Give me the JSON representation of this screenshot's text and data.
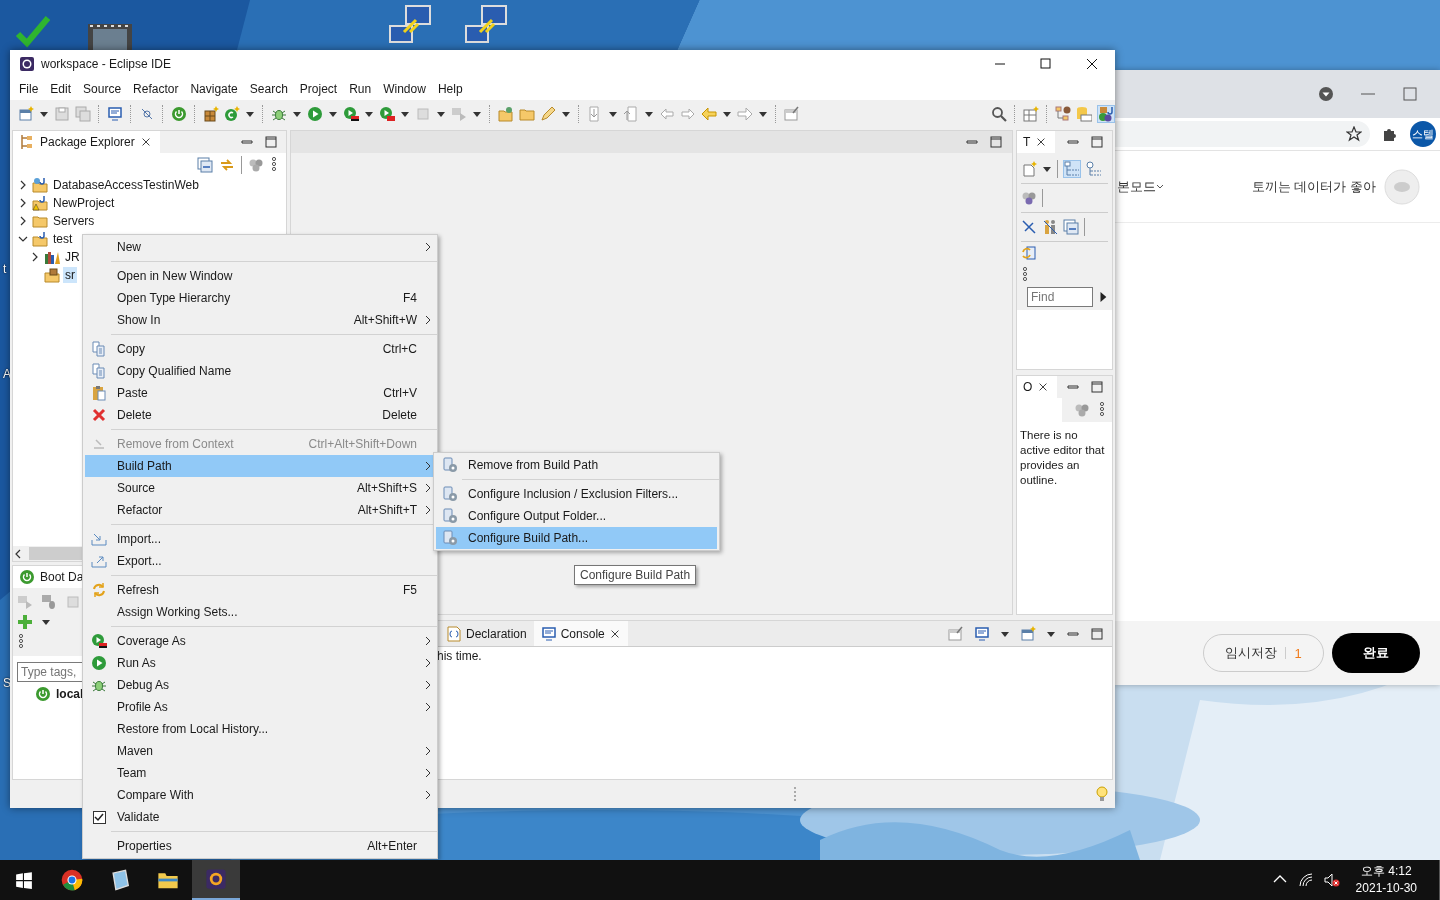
{
  "desktop": {
    "edge_labels": [
      "t",
      "A",
      "S"
    ]
  },
  "browser": {
    "mode_menu": "본모드",
    "blog_name": "토끼는 데이터가 좋아",
    "profile_badge": "스텔",
    "draft_button": {
      "label": "임시저장",
      "count": "1"
    },
    "done_button": "완료"
  },
  "window": {
    "title": "workspace - Eclipse IDE"
  },
  "menu_bar": [
    "File",
    "Edit",
    "Source",
    "Refactor",
    "Navigate",
    "Search",
    "Project",
    "Run",
    "Window",
    "Help"
  ],
  "package_explorer": {
    "title": "Package Explorer",
    "tree": [
      {
        "label": "DatabaseAccessTestinWeb",
        "kind": "web-project",
        "expanded": false,
        "selected": false
      },
      {
        "label": "NewProject",
        "kind": "warning-project",
        "expanded": false,
        "selected": false
      },
      {
        "label": "Servers",
        "kind": "folder",
        "expanded": false,
        "selected": false
      },
      {
        "label": "test",
        "kind": "project",
        "expanded": true,
        "selected": false,
        "children": [
          {
            "label": "JR",
            "kind": "library",
            "expanded": false,
            "selected": false
          },
          {
            "label": "sr",
            "kind": "source",
            "selected": true
          }
        ]
      }
    ]
  },
  "boot_dashboard": {
    "title": "Boot Da",
    "filter_placeholder": "Type tags,",
    "items": [
      {
        "label": "local"
      }
    ]
  },
  "task_list": {
    "title": "T",
    "find_placeholder": "Find"
  },
  "outline": {
    "title": "O",
    "message": "There is no active editor that provides an outline."
  },
  "bottom_panel": {
    "tabs": [
      {
        "label": "Declaration",
        "selected": false
      },
      {
        "label": "Console",
        "selected": true
      }
    ],
    "console_text": "his time."
  },
  "context_menu": {
    "items": [
      {
        "kind": "item",
        "label": "New",
        "submenu": true,
        "selected": false,
        "disabled": false
      },
      {
        "kind": "separator"
      },
      {
        "kind": "item",
        "label": "Open in New Window",
        "submenu": false,
        "selected": false,
        "disabled": false
      },
      {
        "kind": "item",
        "label": "Open Type Hierarchy",
        "shortcut": "F4",
        "submenu": false,
        "selected": false,
        "disabled": false
      },
      {
        "kind": "item",
        "label": "Show In",
        "shortcut": "Alt+Shift+W",
        "submenu": true,
        "selected": false,
        "disabled": false
      },
      {
        "kind": "separator"
      },
      {
        "kind": "item",
        "label": "Copy",
        "shortcut": "Ctrl+C",
        "submenu": false,
        "selected": false,
        "disabled": false
      },
      {
        "kind": "item",
        "label": "Copy Qualified Name",
        "submenu": false,
        "selected": false,
        "disabled": false
      },
      {
        "kind": "item",
        "label": "Paste",
        "shortcut": "Ctrl+V",
        "submenu": false,
        "selected": false,
        "disabled": false
      },
      {
        "kind": "item",
        "label": "Delete",
        "shortcut": "Delete",
        "submenu": false,
        "selected": false,
        "disabled": false
      },
      {
        "kind": "separator"
      },
      {
        "kind": "item",
        "label": "Remove from Context",
        "shortcut": "Ctrl+Alt+Shift+Down",
        "submenu": false,
        "selected": false,
        "disabled": true
      },
      {
        "kind": "item",
        "label": "Build Path",
        "submenu": true,
        "selected": true,
        "disabled": false
      },
      {
        "kind": "item",
        "label": "Source",
        "shortcut": "Alt+Shift+S",
        "submenu": true,
        "selected": false,
        "disabled": false
      },
      {
        "kind": "item",
        "label": "Refactor",
        "shortcut": "Alt+Shift+T",
        "submenu": true,
        "selected": false,
        "disabled": false
      },
      {
        "kind": "separator"
      },
      {
        "kind": "item",
        "label": "Import...",
        "submenu": false,
        "selected": false,
        "disabled": false
      },
      {
        "kind": "item",
        "label": "Export...",
        "submenu": false,
        "selected": false,
        "disabled": false
      },
      {
        "kind": "separator"
      },
      {
        "kind": "item",
        "label": "Refresh",
        "shortcut": "F5",
        "submenu": false,
        "selected": false,
        "disabled": false
      },
      {
        "kind": "item",
        "label": "Assign Working Sets...",
        "submenu": false,
        "selected": false,
        "disabled": false
      },
      {
        "kind": "separator"
      },
      {
        "kind": "item",
        "label": "Coverage As",
        "submenu": true,
        "selected": false,
        "disabled": false
      },
      {
        "kind": "item",
        "label": "Run As",
        "submenu": true,
        "selected": false,
        "disabled": false
      },
      {
        "kind": "item",
        "label": "Debug As",
        "submenu": true,
        "selected": false,
        "disabled": false
      },
      {
        "kind": "item",
        "label": "Profile As",
        "submenu": true,
        "selected": false,
        "disabled": false
      },
      {
        "kind": "item",
        "label": "Restore from Local History...",
        "submenu": false,
        "selected": false,
        "disabled": false
      },
      {
        "kind": "item",
        "label": "Maven",
        "submenu": true,
        "selected": false,
        "disabled": false
      },
      {
        "kind": "item",
        "label": "Team",
        "submenu": true,
        "selected": false,
        "disabled": false
      },
      {
        "kind": "item",
        "label": "Compare With",
        "submenu": true,
        "selected": false,
        "disabled": false
      },
      {
        "kind": "check",
        "label": "Validate",
        "checked": true,
        "submenu": false,
        "selected": false,
        "disabled": false
      },
      {
        "kind": "separator"
      },
      {
        "kind": "item",
        "label": "Properties",
        "shortcut": "Alt+Enter",
        "submenu": false,
        "selected": false,
        "disabled": false
      }
    ]
  },
  "submenu": {
    "items": [
      {
        "kind": "item",
        "label": "Remove from Build Path",
        "selected": false
      },
      {
        "kind": "separator"
      },
      {
        "kind": "item",
        "label": "Configure Inclusion / Exclusion Filters...",
        "selected": false
      },
      {
        "kind": "item",
        "label": "Configure Output Folder...",
        "selected": false
      },
      {
        "kind": "item",
        "label": "Configure Build Path...",
        "selected": true
      }
    ]
  },
  "tooltip": "Configure Build Path",
  "taskbar": {
    "apps": [
      {
        "selected": false
      },
      {
        "selected": false
      },
      {
        "selected": false
      },
      {
        "selected": true
      }
    ],
    "time": "오후 4:12",
    "date": "2021-10-30"
  }
}
